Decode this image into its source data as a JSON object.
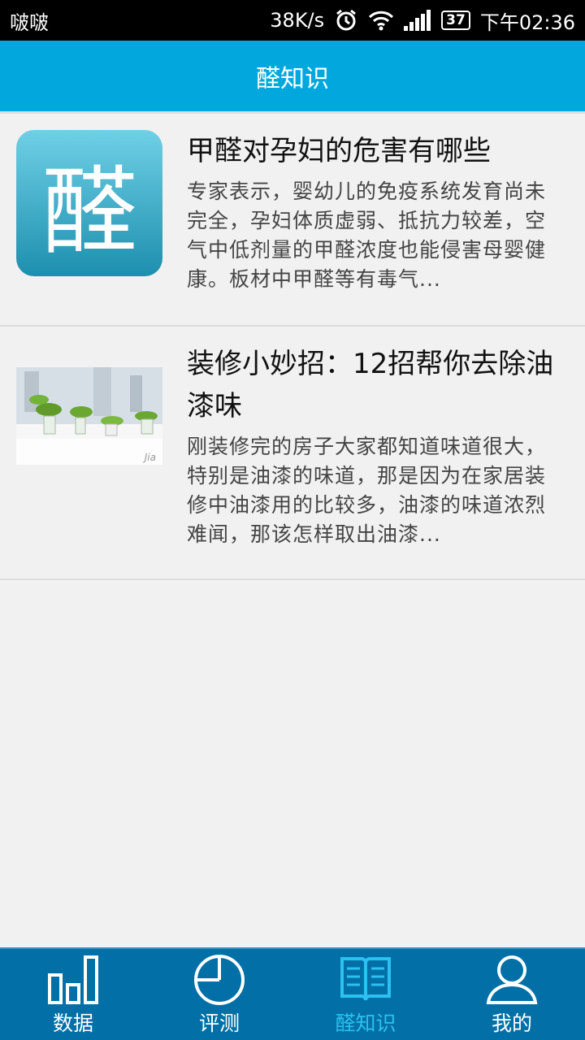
{
  "statusbar": {
    "carrier": "啵啵",
    "speed": "38K/s",
    "battery": "37",
    "time": "下午02:36"
  },
  "header": {
    "title": "醛知识"
  },
  "articles": [
    {
      "title": "甲醛对孕妇的危害有哪些",
      "summary": "专家表示，婴幼儿的免疫系统发育尚未完全，孕妇体质虚弱、抵抗力较差，空气中低剂量的甲醛浓度也能侵害母婴健康。板材中甲醛等有毒气...",
      "thumb_text": "醛"
    },
    {
      "title": "装修小妙招：12招帮你去除油漆味",
      "summary": "刚装修完的房子大家都知道味道很大，特别是油漆的味道，那是因为在家居装修中油漆用的比较多，油漆的味道浓烈难闻，那该怎样取出油漆...",
      "thumb_watermark": "Jia"
    }
  ],
  "tabs": [
    {
      "label": "数据",
      "icon": "bar-chart-icon"
    },
    {
      "label": "评测",
      "icon": "pie-chart-icon"
    },
    {
      "label": "醛知识",
      "icon": "book-icon",
      "active": true
    },
    {
      "label": "我的",
      "icon": "user-icon"
    }
  ],
  "colors": {
    "accent": "#02a8dd",
    "tabbar": "#0270a6",
    "active_tab": "#2bc1f0"
  }
}
